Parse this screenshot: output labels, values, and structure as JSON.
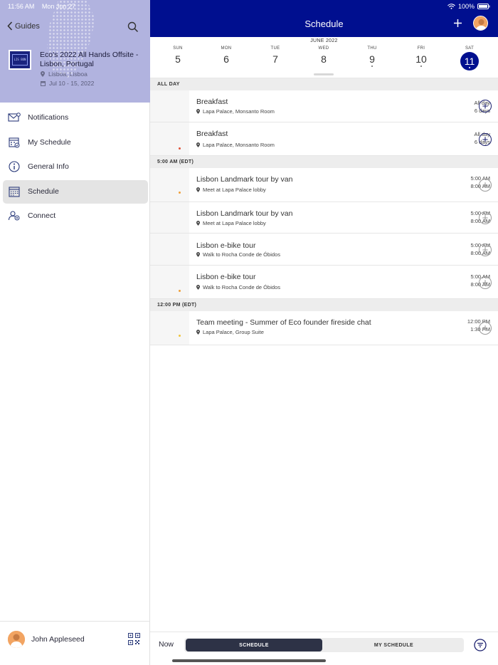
{
  "status_bar": {
    "time": "11:56 AM",
    "date": "Mon Jun 27",
    "battery": "100%"
  },
  "sidebar": {
    "back_label": "Guides",
    "event": {
      "thumb_text": "LIS BON",
      "title": "Eco's 2022 All Hands Offsite - Lisbon, Portugal",
      "location": "Lisboa, Lisboa",
      "dates": "Jul 10 - 15, 2022"
    },
    "nav": [
      {
        "label": "Notifications",
        "icon": "envelope-icon"
      },
      {
        "label": "My Schedule",
        "icon": "calendar-check-icon"
      },
      {
        "label": "General Info",
        "icon": "info-icon"
      },
      {
        "label": "Schedule",
        "icon": "calendar-grid-icon",
        "active": true
      },
      {
        "label": "Connect",
        "icon": "people-icon"
      }
    ],
    "user_name": "John Appleseed"
  },
  "header": {
    "title": "Schedule"
  },
  "datebar": {
    "month": "JUNE 2022",
    "days": [
      {
        "dow": "SUN",
        "num": "5",
        "dot": false
      },
      {
        "dow": "MON",
        "num": "6",
        "dot": false
      },
      {
        "dow": "TUE",
        "num": "7",
        "dot": false
      },
      {
        "dow": "WED",
        "num": "8",
        "dot": false
      },
      {
        "dow": "THU",
        "num": "9",
        "dot": true
      },
      {
        "dow": "FRI",
        "num": "10",
        "dot": true
      },
      {
        "dow": "SAT",
        "num": "11",
        "selected": true
      }
    ]
  },
  "sections": [
    {
      "label": "ALL DAY",
      "items": [
        {
          "t1": "All day",
          "t2": "6 days",
          "title": "Breakfast",
          "location": "Lapa Palace, Monsanto Room",
          "dot": null,
          "dark_add": true
        },
        {
          "t1": "All day",
          "t2": "6 days",
          "title": "Breakfast",
          "location": "Lapa Palace, Monsanto Room",
          "dot": "#e0533a",
          "dark_add": true
        }
      ]
    },
    {
      "label": "5:00 AM (EDT)",
      "items": [
        {
          "t1": "5:00 AM",
          "t2": "8:00 AM",
          "title": "Lisbon Landmark tour by van",
          "location": "Meet at Lapa Palace lobby",
          "dot": "#f0a03a",
          "dark_add": false
        },
        {
          "t1": "5:00 AM",
          "t2": "8:00 AM",
          "title": "Lisbon Landmark tour by van",
          "location": "Meet at Lapa Palace lobby",
          "dot": null,
          "dark_add": false
        },
        {
          "t1": "5:00 AM",
          "t2": "8:00 AM",
          "title": "Lisbon e-bike tour",
          "location": "Walk to Rocha Conde de Óbidos",
          "dot": null,
          "dark_add": false
        },
        {
          "t1": "5:00 AM",
          "t2": "8:00 AM",
          "title": "Lisbon e-bike tour",
          "location": "Walk to Rocha Conde de Óbidos",
          "dot": "#f0a03a",
          "dark_add": false
        }
      ]
    },
    {
      "label": "12:00 PM (EDT)",
      "items": [
        {
          "t1": "12:00 PM",
          "t2": "1:30 PM",
          "title": "Team meeting - Summer of Eco founder fireside chat",
          "location": "Lapa Palace, Group Suite",
          "dot": "#f0c53a",
          "dark_add": false
        }
      ]
    }
  ],
  "bottom": {
    "now": "Now",
    "tab_schedule": "SCHEDULE",
    "tab_my_schedule": "MY SCHEDULE"
  }
}
